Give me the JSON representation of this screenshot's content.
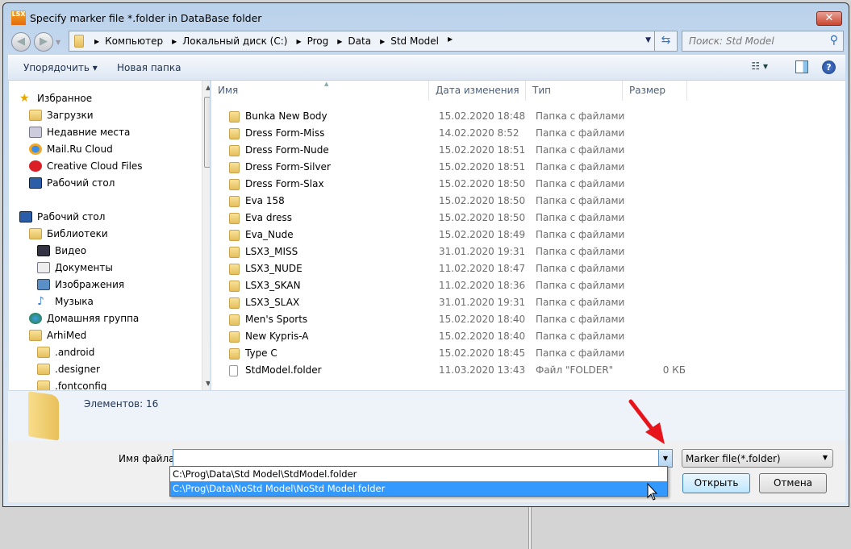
{
  "window": {
    "title": "Specify marker file *.folder in DataBase folder",
    "logo_text": "LSX",
    "close": "✕"
  },
  "address": {
    "crumbs": [
      "Компьютер",
      "Локальный диск (C:)",
      "Prog",
      "Data",
      "Std Model"
    ]
  },
  "search": {
    "placeholder": "Поиск: Std Model"
  },
  "toolbar": {
    "organize": "Упорядочить ▾",
    "new_folder": "Новая папка",
    "help": "?"
  },
  "nav": {
    "favorites_header": "Избранное",
    "favorites": [
      "Загрузки",
      "Недавние места",
      "Mail.Ru Cloud",
      "Creative Cloud Files",
      "Рабочий стол"
    ],
    "desktop": "Рабочий стол",
    "libraries": "Библиотеки",
    "library_items": [
      "Видео",
      "Документы",
      "Изображения",
      "Музыка"
    ],
    "homegroup": "Домашняя группа",
    "user": "ArhiMed",
    "user_items": [
      ".android",
      ".designer",
      ".fontconfig"
    ]
  },
  "columns": {
    "name": "Имя",
    "date": "Дата изменения",
    "type": "Тип",
    "size": "Размер"
  },
  "files": [
    {
      "name": "Bunka New Body",
      "date": "15.02.2020 18:48",
      "type": "Папка с файлами",
      "size": ""
    },
    {
      "name": "Dress Form-Miss",
      "date": "14.02.2020 8:52",
      "type": "Папка с файлами",
      "size": ""
    },
    {
      "name": "Dress Form-Nude",
      "date": "15.02.2020 18:51",
      "type": "Папка с файлами",
      "size": ""
    },
    {
      "name": "Dress Form-Silver",
      "date": "15.02.2020 18:51",
      "type": "Папка с файлами",
      "size": ""
    },
    {
      "name": "Dress Form-Slax",
      "date": "15.02.2020 18:50",
      "type": "Папка с файлами",
      "size": ""
    },
    {
      "name": "Eva 158",
      "date": "15.02.2020 18:50",
      "type": "Папка с файлами",
      "size": ""
    },
    {
      "name": "Eva dress",
      "date": "15.02.2020 18:50",
      "type": "Папка с файлами",
      "size": ""
    },
    {
      "name": "Eva_Nude",
      "date": "15.02.2020 18:49",
      "type": "Папка с файлами",
      "size": ""
    },
    {
      "name": "LSX3_MISS",
      "date": "31.01.2020 19:31",
      "type": "Папка с файлами",
      "size": ""
    },
    {
      "name": "LSX3_NUDE",
      "date": "11.02.2020 18:47",
      "type": "Папка с файлами",
      "size": ""
    },
    {
      "name": "LSX3_SKAN",
      "date": "11.02.2020 18:36",
      "type": "Папка с файлами",
      "size": ""
    },
    {
      "name": "LSX3_SLAX",
      "date": "31.01.2020 19:31",
      "type": "Папка с файлами",
      "size": ""
    },
    {
      "name": "Men's Sports",
      "date": "15.02.2020 18:40",
      "type": "Папка с файлами",
      "size": ""
    },
    {
      "name": "New Kypris-A",
      "date": "15.02.2020 18:40",
      "type": "Папка с файлами",
      "size": ""
    },
    {
      "name": "Type C",
      "date": "15.02.2020 18:45",
      "type": "Папка с файлами",
      "size": ""
    },
    {
      "name": "StdModel.folder",
      "date": "11.03.2020 13:43",
      "type": "Файл \"FOLDER\"",
      "size": "0 КБ",
      "is_file": true
    }
  ],
  "details": {
    "count": "Элементов: 16"
  },
  "bottom": {
    "filename_label": "Имя файла:",
    "filename_value": "",
    "filter": "Marker file(*.folder)",
    "open": "Открыть",
    "cancel": "Отмена",
    "suggestions": [
      "C:\\Prog\\Data\\Std Model\\StdModel.folder",
      "C:\\Prog\\Data\\NoStd Model\\NoStd Model.folder"
    ],
    "selected_suggestion": 1
  },
  "colors": {
    "accent": "#3399ff",
    "annotation_arrow": "#e8141b"
  }
}
